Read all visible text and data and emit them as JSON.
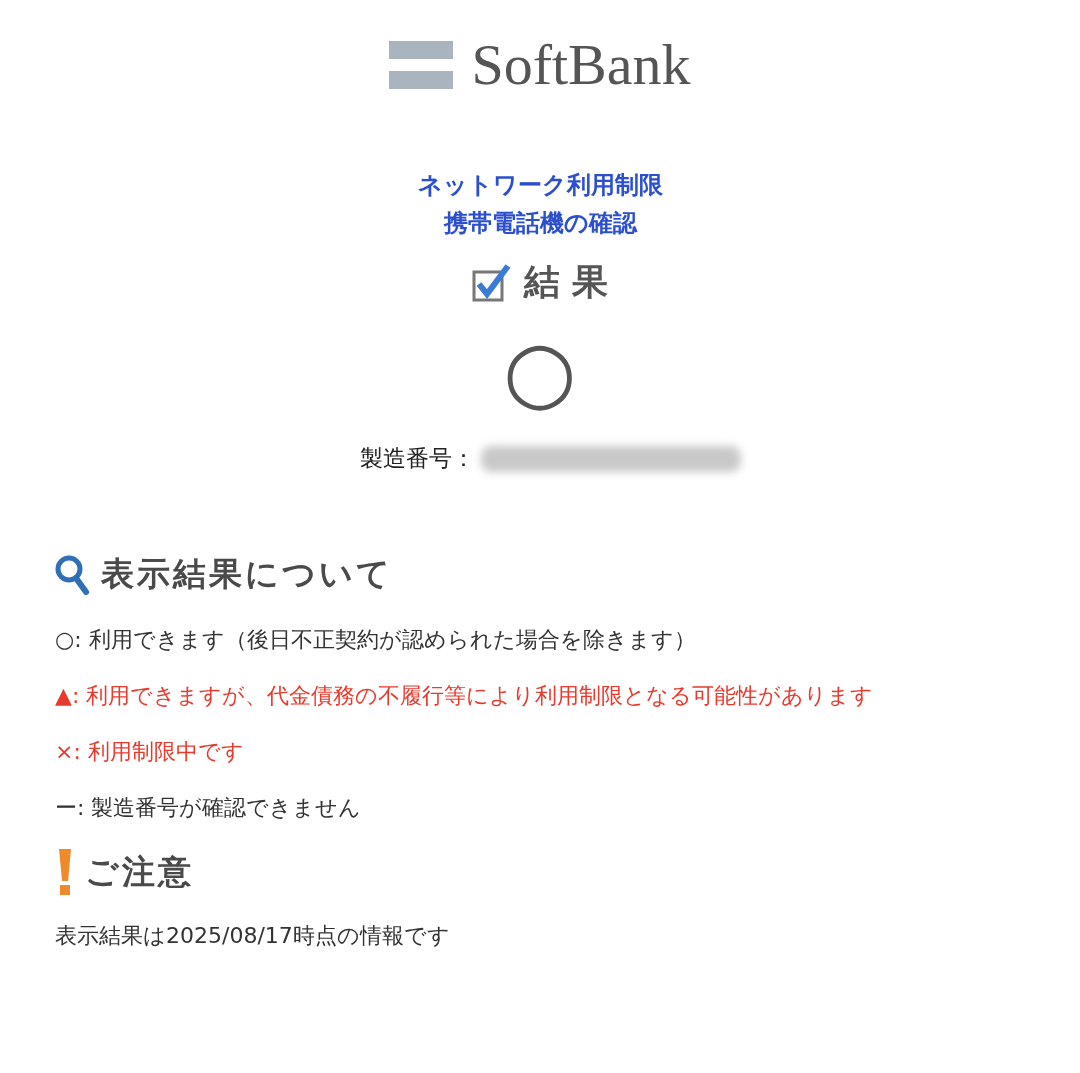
{
  "logo": {
    "text": "SoftBank"
  },
  "title_lines": [
    "ネットワーク利用制限",
    "携帯電話機の確認"
  ],
  "result_heading": "結 果",
  "result": {
    "symbol": "○"
  },
  "serial": {
    "label": "製造番号："
  },
  "legend_heading": "表示結果について",
  "legend": [
    {
      "text": "○: 利用できます（後日不正契約が認められた場合を除きます）",
      "color": "#333333"
    },
    {
      "text": "▲: 利用できますが、代金債務の不履行等により利用制限となる可能性があります",
      "color": "#e8392d"
    },
    {
      "text": "×: 利用制限中です",
      "color": "#e8392d"
    },
    {
      "text": "ー: 製造番号が確認できません",
      "color": "#333333"
    }
  ],
  "notice_heading": "ご注意",
  "notice": "表示結果は2025/08/17時点の情報です"
}
